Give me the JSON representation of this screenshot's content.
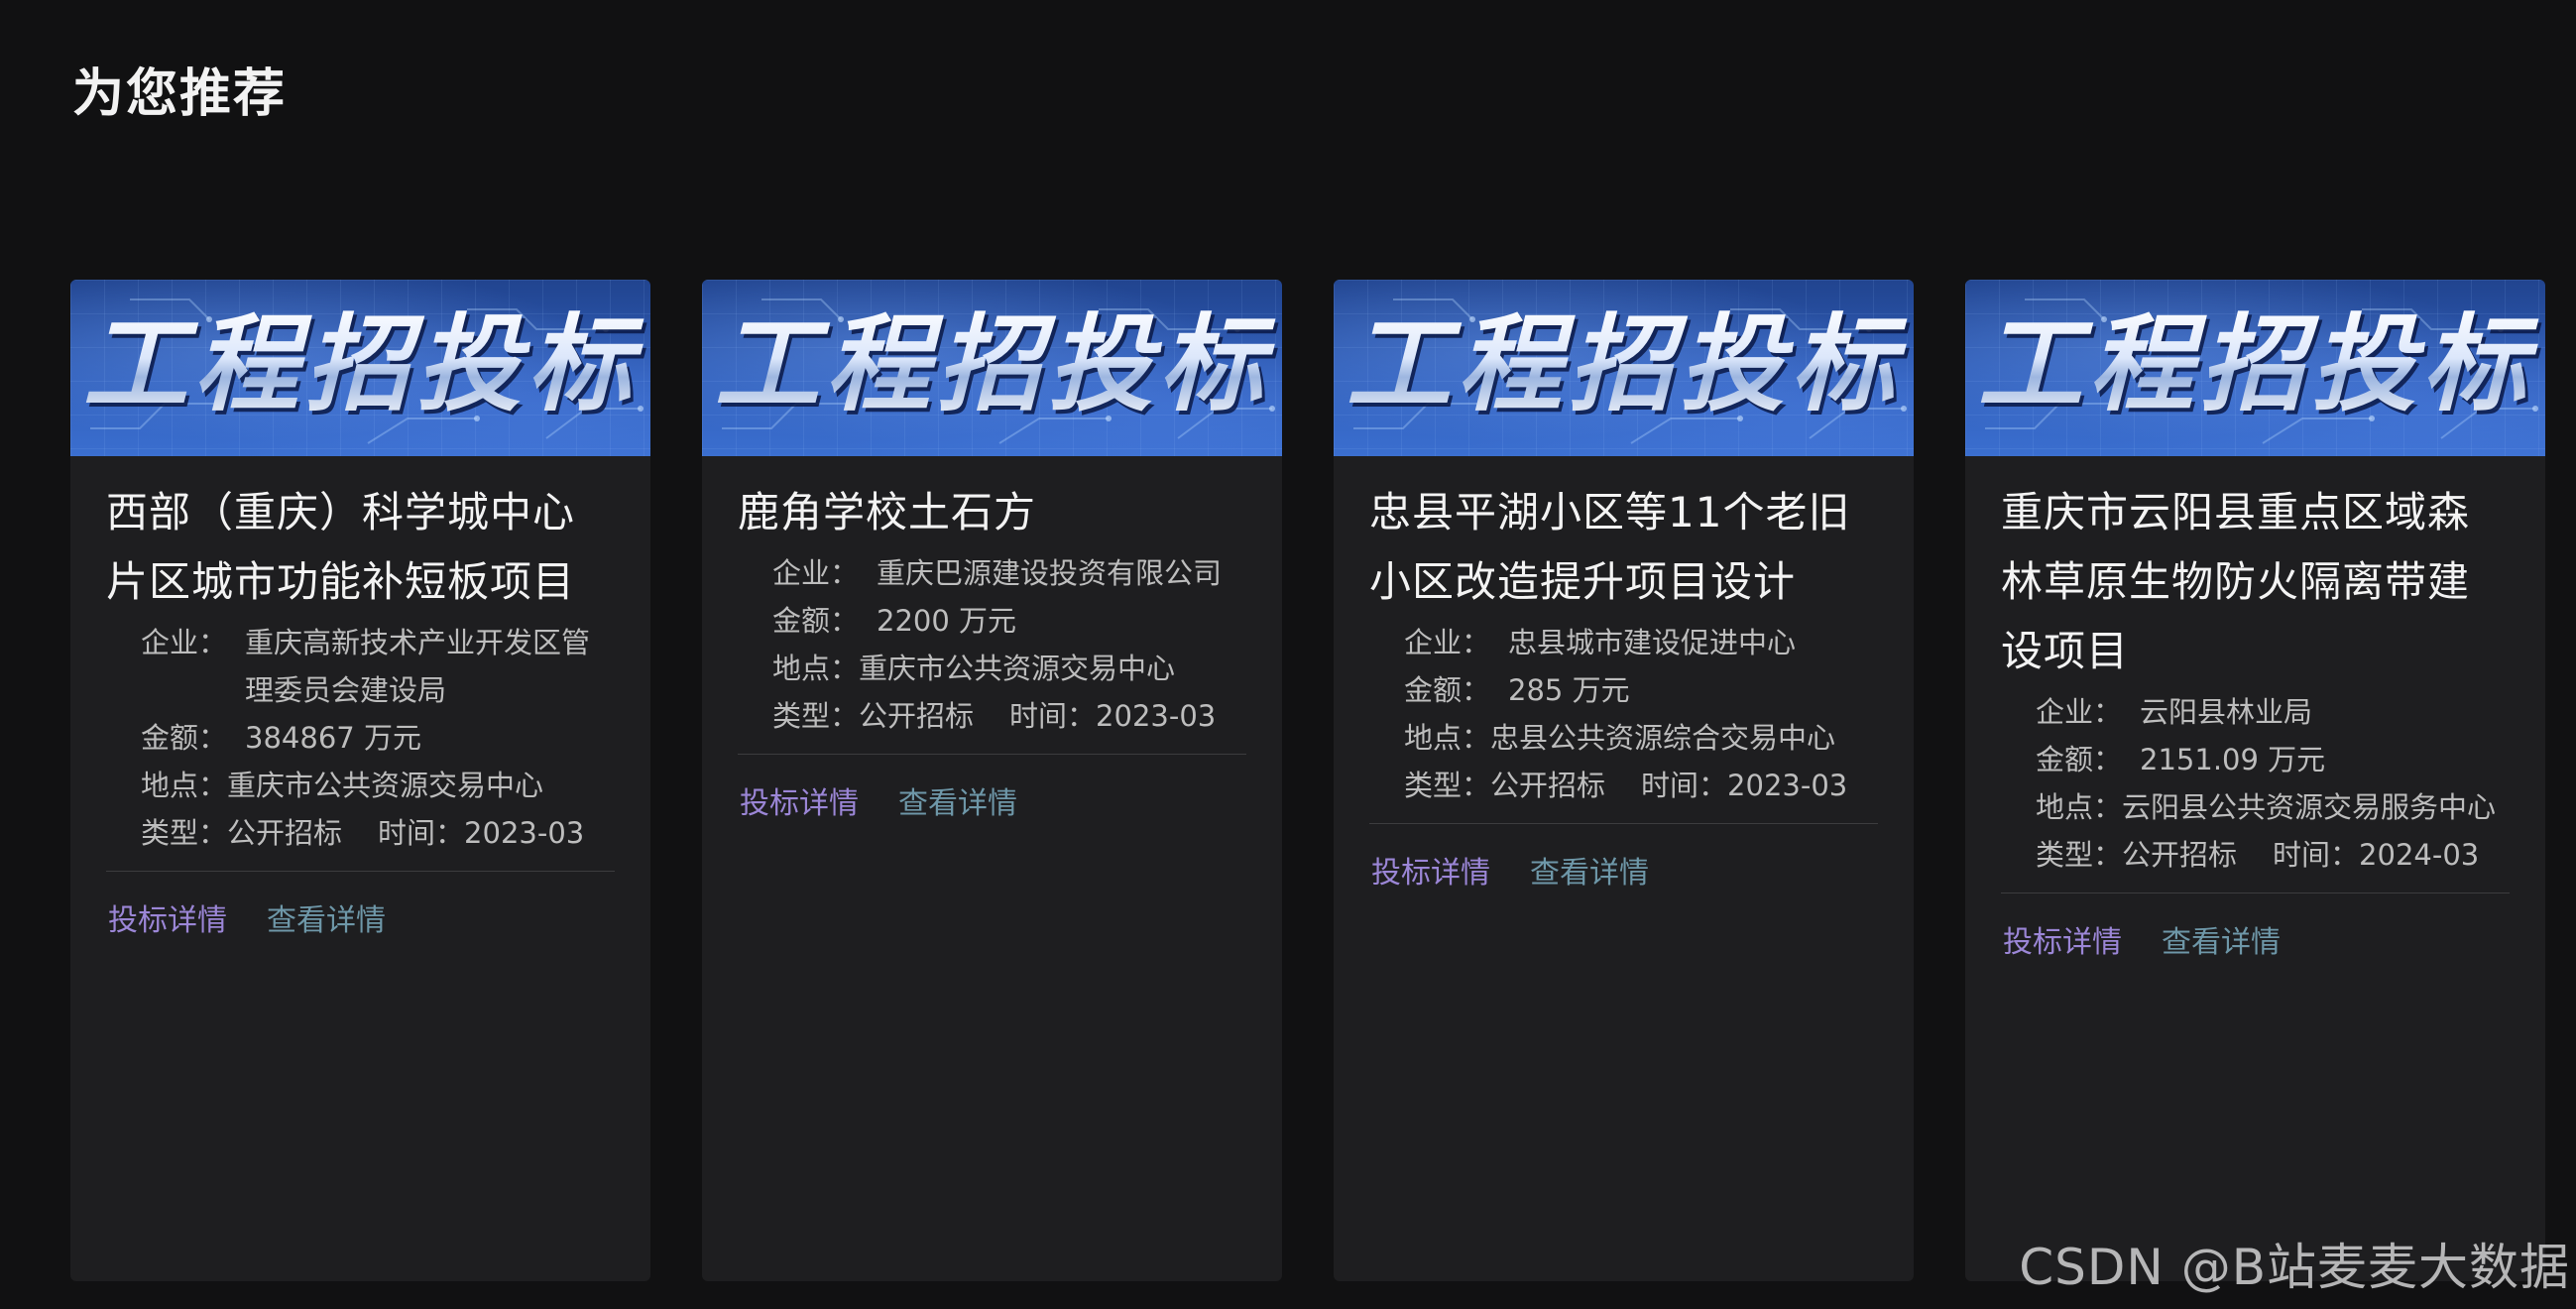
{
  "section_title": "为您推荐",
  "banner_text": "工程招投标",
  "labels": {
    "company": "企业：",
    "amount": "金额：",
    "location": "地点：",
    "type": "类型：",
    "time": "时间："
  },
  "actions": {
    "bid": "投标详情",
    "view": "查看详情"
  },
  "cards": [
    {
      "title": "西部（重庆）科学城中心片区城市功能补短板项目",
      "company": "重庆高新技术产业开发区管理委员会建设局",
      "amount": "384867 万元",
      "location": "重庆市公共资源交易中心",
      "type": "公开招标",
      "time": "2023-03"
    },
    {
      "title": "鹿角学校土石方",
      "company": "重庆巴源建设投资有限公司",
      "amount": "2200 万元",
      "location": "重庆市公共资源交易中心",
      "type": "公开招标",
      "time": "2023-03"
    },
    {
      "title": "忠县平湖小区等11个老旧小区改造提升项目设计",
      "company": "忠县城市建设促进中心",
      "amount": "285 万元",
      "location": "忠县公共资源综合交易中心",
      "type": "公开招标",
      "time": "2023-03"
    },
    {
      "title": "重庆市云阳县重点区域森林草原生物防火隔离带建设项目",
      "company": "云阳县林业局",
      "amount": "2151.09 万元",
      "location": "云阳县公共资源交易服务中心",
      "type": "公开招标",
      "time": "2024-03"
    }
  ],
  "watermark": "CSDN @B站麦麦大数据"
}
